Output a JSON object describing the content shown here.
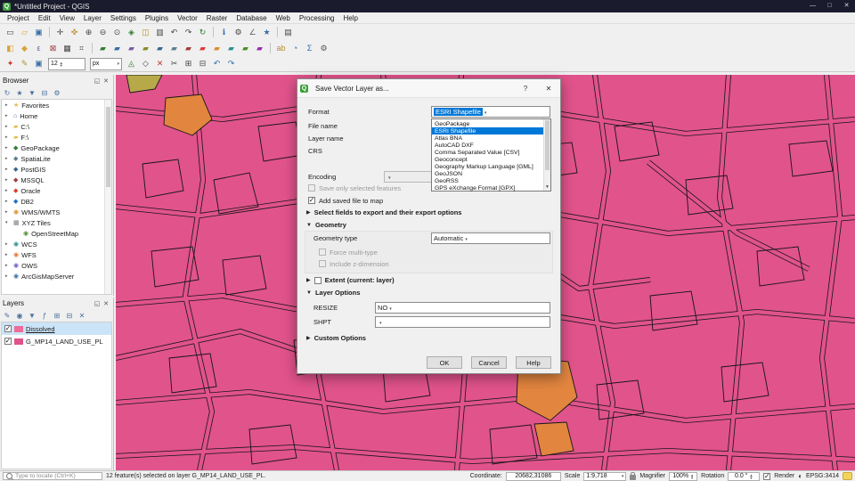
{
  "colors": {
    "titlebar-bg": "#1b1b2e",
    "accent-blue": "#0078d7",
    "map-pink": "#e1538b",
    "map-line": "#161616",
    "map-orange": "#e2853f",
    "map-olive": "#b7a84a",
    "selection-blue": "#cce4f7"
  },
  "window": {
    "title": "*Untitled Project - QGIS",
    "logo": "Q",
    "minimize": "—",
    "maximize": "□",
    "close": "✕"
  },
  "menu": {
    "items": [
      {
        "name": "menu-project",
        "label": "Project"
      },
      {
        "name": "menu-edit",
        "label": "Edit"
      },
      {
        "name": "menu-view",
        "label": "View"
      },
      {
        "name": "menu-layer",
        "label": "Layer"
      },
      {
        "name": "menu-settings",
        "label": "Settings"
      },
      {
        "name": "menu-plugins",
        "label": "Plugins"
      },
      {
        "name": "menu-vector",
        "label": "Vector"
      },
      {
        "name": "menu-raster",
        "label": "Raster"
      },
      {
        "name": "menu-database",
        "label": "Database"
      },
      {
        "name": "menu-web",
        "label": "Web"
      },
      {
        "name": "menu-processing",
        "label": "Processing"
      },
      {
        "name": "menu-help",
        "label": "Help"
      }
    ]
  },
  "toolbars": {
    "row1": [
      {
        "name": "new-project-icon",
        "g": "▭"
      },
      {
        "name": "open-project-icon",
        "g": "▱",
        "c": "#d9a33b"
      },
      {
        "name": "save-project-icon",
        "g": "▣",
        "c": "#3a6ea5"
      },
      {
        "sep": true
      },
      {
        "name": "pan-map-icon",
        "g": "✛"
      },
      {
        "name": "pan-to-selection-icon",
        "g": "✜",
        "c": "#b38f2d"
      },
      {
        "name": "zoom-in-icon",
        "g": "⊕"
      },
      {
        "name": "zoom-out-icon",
        "g": "⊖"
      },
      {
        "name": "zoom-native-icon",
        "g": "⊙"
      },
      {
        "name": "zoom-full-icon",
        "g": "◈",
        "c": "#2e7d32"
      },
      {
        "name": "zoom-to-selection-icon",
        "g": "◫",
        "c": "#b38f2d"
      },
      {
        "name": "zoom-to-layer-icon",
        "g": "▥"
      },
      {
        "name": "zoom-last-icon",
        "g": "↶"
      },
      {
        "name": "zoom-next-icon",
        "g": "↷"
      },
      {
        "name": "map-refresh-icon",
        "g": "↻",
        "c": "#2e7d32"
      },
      {
        "sep": true
      },
      {
        "name": "identify-features-icon",
        "g": "ℹ",
        "c": "#2f6fb5"
      },
      {
        "name": "run-feature-action-icon",
        "g": "⚙"
      },
      {
        "name": "measure-line-icon",
        "g": "∠",
        "c": "#666"
      },
      {
        "name": "spatial-bookmarks-icon",
        "g": "★",
        "c": "#3a6ea5"
      },
      {
        "sep": true
      },
      {
        "name": "new-map-view-icon",
        "g": "▤"
      }
    ],
    "row2": [
      {
        "name": "select-features-icon",
        "g": "◧",
        "c": "#d9a33b"
      },
      {
        "name": "select-by-polygon-icon",
        "g": "◆",
        "c": "#d9a33b"
      },
      {
        "name": "select-by-expression-icon",
        "g": "ε",
        "c": "#7a5aa6"
      },
      {
        "name": "deselect-all-icon",
        "g": "⊠",
        "c": "#a33c3c"
      },
      {
        "name": "open-attribute-table-icon",
        "g": "▦"
      },
      {
        "name": "field-calculator-icon",
        "g": "⌗",
        "c": "#555"
      },
      {
        "sep": true
      },
      {
        "name": "add-vector-layer-icon",
        "g": "▰",
        "c": "#2e7d32"
      },
      {
        "name": "add-raster-layer-icon",
        "g": "▰",
        "c": "#3a6ea5"
      },
      {
        "name": "add-mesh-layer-icon",
        "g": "▰",
        "c": "#7b5aa6"
      },
      {
        "name": "add-delimited-text-icon",
        "g": "▰",
        "c": "#8a8a2a"
      },
      {
        "name": "add-postgis-layer-icon",
        "g": "▰",
        "c": "#336791"
      },
      {
        "name": "add-spatialite-layer-icon",
        "g": "▰",
        "c": "#5f7d8c"
      },
      {
        "name": "add-mssql-layer-icon",
        "g": "▰",
        "c": "#a33c3c"
      },
      {
        "name": "add-oracle-layer-icon",
        "g": "▰",
        "c": "#e03c31"
      },
      {
        "name": "add-wms-layer-icon",
        "g": "▰",
        "c": "#d98f2b"
      },
      {
        "name": "add-wcs-layer-icon",
        "g": "▰",
        "c": "#2a8f8f"
      },
      {
        "name": "add-wfs-layer-icon",
        "g": "▰",
        "c": "#4a8f2a"
      },
      {
        "name": "add-xyz-layer-icon",
        "g": "▰",
        "c": "#9c27b0"
      },
      {
        "sep": true
      },
      {
        "name": "layer-labeling-icon",
        "g": "ab",
        "c": "#b38f2d"
      },
      {
        "name": "layer-diagram-icon",
        "g": "◔",
        "c": "#2f6fb5"
      },
      {
        "name": "statistical-summary-icon",
        "g": "Σ",
        "c": "#2f6fb5"
      },
      {
        "name": "processing-toolbox-icon",
        "g": "⚙",
        "c": "#555"
      }
    ],
    "row3_left": [
      {
        "name": "current-edits-icon",
        "g": "✦",
        "c": "#c0392b"
      },
      {
        "name": "toggle-editing-icon",
        "g": "✎",
        "c": "#b38f2d"
      },
      {
        "name": "save-edits-icon",
        "g": "▣",
        "c": "#3a6ea5"
      }
    ],
    "size_value": "12",
    "unit_value": "px",
    "row3_right": [
      {
        "name": "add-feature-icon",
        "g": "◬",
        "c": "#2e7d32"
      },
      {
        "name": "vertex-tool-icon",
        "g": "◇"
      },
      {
        "name": "delete-selected-icon",
        "g": "✕",
        "c": "#c0392b"
      },
      {
        "name": "cut-features-icon",
        "g": "✂"
      },
      {
        "name": "copy-features-icon",
        "g": "⊞"
      },
      {
        "name": "paste-features-icon",
        "g": "⊟"
      },
      {
        "name": "undo-icon",
        "g": "↶",
        "c": "#2f6fb5"
      },
      {
        "name": "redo-icon",
        "g": "↷",
        "c": "#2f6fb5"
      }
    ]
  },
  "browser": {
    "title": "Browser",
    "header_icons": [
      {
        "name": "browser-refresh-icon",
        "g": "↻"
      },
      {
        "name": "browser-add-favorite-icon",
        "g": "★"
      },
      {
        "name": "browser-filter-icon",
        "g": "▼"
      },
      {
        "name": "browser-collapse-all-icon",
        "g": "⊟"
      },
      {
        "name": "browser-properties-icon",
        "g": "⚙"
      }
    ],
    "items": [
      {
        "name": "browser-item-favorites",
        "arrow": "▸",
        "glyph": "★",
        "color": "#e8b84b",
        "label": "Favorites"
      },
      {
        "name": "browser-item-home",
        "arrow": "▸",
        "glyph": "⌂",
        "color": "#3a6ea5",
        "label": "Home"
      },
      {
        "name": "browser-item-c-drive",
        "arrow": "▸",
        "glyph": "▰",
        "color": "#e8b84b",
        "label": "C:\\"
      },
      {
        "name": "browser-item-f-drive",
        "arrow": "▸",
        "glyph": "▰",
        "color": "#e8b84b",
        "label": "F:\\"
      },
      {
        "name": "browser-item-geopackage",
        "arrow": "▸",
        "glyph": "◆",
        "color": "#2e7d32",
        "label": "GeoPackage"
      },
      {
        "name": "browser-item-spatialite",
        "arrow": "▸",
        "glyph": "◆",
        "color": "#5f7d8c",
        "label": "SpatiaLite"
      },
      {
        "name": "browser-item-postgis",
        "arrow": "▸",
        "glyph": "◆",
        "color": "#336791",
        "label": "PostGIS"
      },
      {
        "name": "browser-item-mssql",
        "arrow": "▸",
        "glyph": "◆",
        "color": "#a33c3c",
        "label": "MSSQL"
      },
      {
        "name": "browser-item-oracle",
        "arrow": "▸",
        "glyph": "◆",
        "color": "#e03c31",
        "label": "Oracle"
      },
      {
        "name": "browser-item-db2",
        "arrow": "▸",
        "glyph": "◆",
        "color": "#1f70c1",
        "label": "DB2"
      },
      {
        "name": "browser-item-wms",
        "arrow": "▸",
        "glyph": "◉",
        "color": "#d98f2b",
        "label": "WMS/WMTS"
      },
      {
        "name": "browser-item-xyz-tiles",
        "arrow": "▾",
        "glyph": "▦",
        "color": "#7a7a7a",
        "label": "XYZ Tiles"
      },
      {
        "name": "browser-item-openstreetmap",
        "arrow": "",
        "indent": 1,
        "glyph": "◉",
        "color": "#4a8f2a",
        "label": "OpenStreetMap"
      },
      {
        "name": "browser-item-wcs",
        "arrow": "▸",
        "glyph": "◉",
        "color": "#2a8f8f",
        "label": "WCS"
      },
      {
        "name": "browser-item-wfs",
        "arrow": "▸",
        "glyph": "◉",
        "color": "#e8762d",
        "label": "WFS"
      },
      {
        "name": "browser-item-ows",
        "arrow": "▸",
        "glyph": "◉",
        "color": "#6a5acd",
        "label": "OWS"
      },
      {
        "name": "browser-item-arcgismapserver",
        "arrow": "▸",
        "glyph": "◉",
        "color": "#3a6ea5",
        "label": "ArcGisMapServer"
      }
    ]
  },
  "layers": {
    "title": "Layers",
    "header_icons": [
      {
        "name": "layer-styling-icon",
        "g": "✎"
      },
      {
        "name": "map-themes-icon",
        "g": "◉"
      },
      {
        "name": "filter-legend-icon",
        "g": "▼"
      },
      {
        "name": "filter-expression-icon",
        "g": "ƒ"
      },
      {
        "name": "expand-all-icon",
        "g": "⊞"
      },
      {
        "name": "collapse-all-icon",
        "g": "⊟"
      },
      {
        "name": "remove-layer-icon",
        "g": "✕"
      }
    ],
    "items": [
      {
        "name": "layer-item-dissolved",
        "label": "Dissolved",
        "checked": true,
        "selected": true,
        "color": "#ee6b9a"
      },
      {
        "name": "layer-item-g-mp14-land-use-pl",
        "label": "G_MP14_LAND_USE_PL",
        "checked": true,
        "color": "#e0528a"
      }
    ]
  },
  "dialog": {
    "title": "Save Vector Layer as...",
    "logo": "Q",
    "help_glyph": "?",
    "close_glyph": "✕",
    "format": {
      "label": "Format",
      "value": "ESRI Shapefile"
    },
    "file_name": {
      "label": "File name",
      "value": ""
    },
    "layer_name": {
      "label": "Layer name",
      "value": ""
    },
    "crs": {
      "label": "CRS",
      "value": ""
    },
    "encoding": {
      "label": "Encoding",
      "value": ""
    },
    "save_only_selected": "Save only selected features",
    "add_saved": "Add saved file to map",
    "sections": {
      "fields_arrow": "▶",
      "fields": "Select fields to export and their export options",
      "geometry_arrow": "▼",
      "geometry": "Geometry",
      "extent_arrow": "▶",
      "extent": "Extent (current: layer)",
      "layer_options_arrow": "▼",
      "layer_options": "Layer Options",
      "custom_arrow": "▶",
      "custom": "Custom Options"
    },
    "geometry_type": {
      "label": "Geometry type",
      "value": "Automatic"
    },
    "force_multi": "Force multi-type",
    "include_z": "Include z-dimension",
    "resize": {
      "label": "RESIZE",
      "value": "NO"
    },
    "shpt": {
      "label": "SHPT",
      "value": ""
    },
    "checks": {
      "save_only": false,
      "add_saved": true,
      "extent": false,
      "force_multi": false,
      "include_z": false
    },
    "buttons": {
      "ok": "OK",
      "cancel": "Cancel",
      "help": "Help"
    },
    "dropdown": {
      "items": [
        {
          "name": "format-option-geopackage",
          "label": "GeoPackage"
        },
        {
          "name": "format-option-esri-shapefile",
          "label": "ESRI Shapefile",
          "selected": true
        },
        {
          "name": "format-option-atlas-bna",
          "label": "Atlas BNA"
        },
        {
          "name": "format-option-autocad-dxf",
          "label": "AutoCAD DXF"
        },
        {
          "name": "format-option-csv",
          "label": "Comma Separated Value [CSV]"
        },
        {
          "name": "format-option-geoconcept",
          "label": "Geoconcept"
        },
        {
          "name": "format-option-gml",
          "label": "Geography Markup Language [GML]"
        },
        {
          "name": "format-option-geojson",
          "label": "GeoJSON"
        },
        {
          "name": "format-option-georss",
          "label": "GeoRSS"
        },
        {
          "name": "format-option-gpx",
          "label": "GPS eXchange Format [GPX]"
        }
      ]
    }
  },
  "statusbar": {
    "locate_placeholder": "Type to locate (Ctrl+K)",
    "message": "12 feature(s) selected on layer G_MP14_LAND_USE_PL.",
    "coordinate_label": "Coordinate:",
    "coordinate_value": "20682,31086",
    "scale_label": "Scale",
    "scale_value": "1:9,718",
    "magnifier_label": "Magnifier",
    "magnifier_value": "100%",
    "rotation_label": "Rotation",
    "rotation_value": "0.0 °",
    "render_label": "Render",
    "render_checked": true,
    "epsg_label": "EPSG:3414"
  }
}
